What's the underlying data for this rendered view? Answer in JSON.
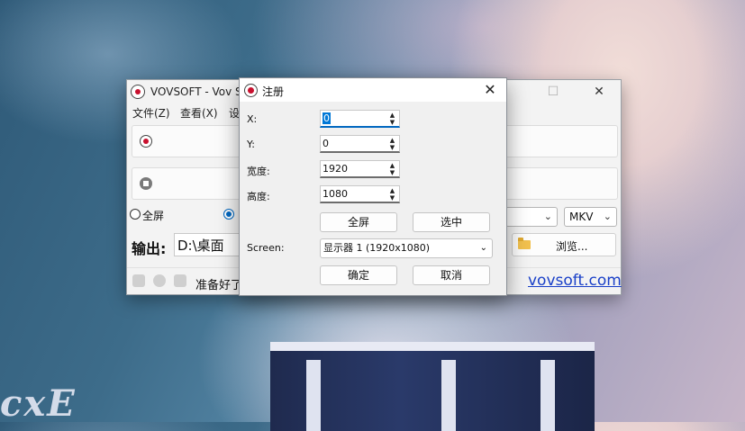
{
  "main_window": {
    "title": "VOVSOFT - Vov Scr",
    "menu": [
      "文件(Z)",
      "查看(X)",
      "设"
    ],
    "radio_fullscreen": "全屏",
    "radio_second": "",
    "format_select": "MKV",
    "output_label": "输出:",
    "output_path": "D:\\桌面",
    "browse_label": "浏览...",
    "status_text": "准备好了",
    "site_link": "vovsoft.com"
  },
  "dialog": {
    "title": "注册",
    "fields": {
      "x": {
        "label": "X:",
        "value": "0"
      },
      "y": {
        "label": "Y:",
        "value": "0"
      },
      "width": {
        "label": "宽度:",
        "value": "1920"
      },
      "height": {
        "label": "高度:",
        "value": "1080"
      }
    },
    "fullscreen_button": "全屏",
    "select_button": "选中",
    "screen_label": "Screen:",
    "screen_value": "显示器 1 (1920x1080)",
    "ok_button": "确定",
    "cancel_button": "取消"
  },
  "wallpaper": {
    "watermark": "cxE"
  },
  "colors": {
    "accent": "#0067c0",
    "record_red": "#c8102e",
    "link": "#1a40c8"
  }
}
